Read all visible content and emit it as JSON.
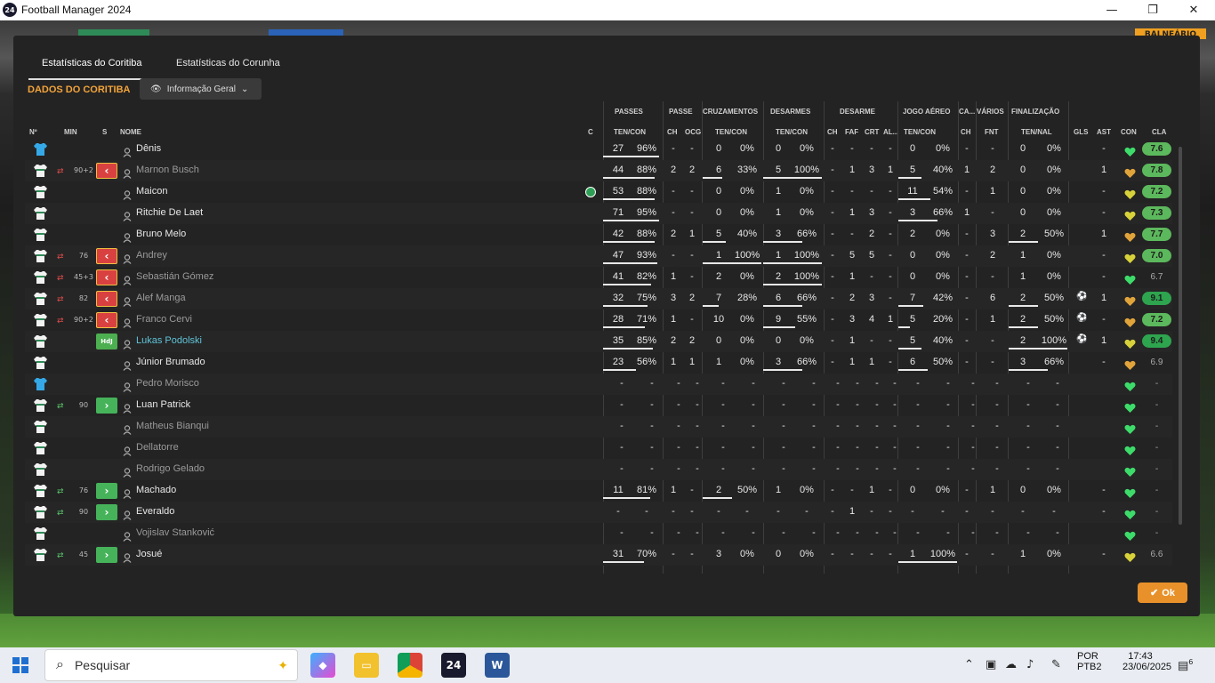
{
  "window": {
    "title": "Football Manager 2024",
    "logo_text": "24",
    "minimize": "—",
    "maximize": "❐",
    "close": "✕"
  },
  "background": {
    "balneario": "BALNEÁRIO"
  },
  "tabs": [
    {
      "label": "Estatísticas do Coritiba",
      "active": true
    },
    {
      "label": "Estatísticas do Corunha",
      "active": false
    }
  ],
  "section_title": "DADOS DO CORITIBA",
  "view_selector": {
    "label": "Informação Geral"
  },
  "group_headers": [
    "PASSES",
    "PASSE",
    "CRUZAMENTOS",
    "DESARMES",
    "DESARME",
    "JOGO AÉREO",
    "CA...",
    "VÁRIOS",
    "FINALIZAÇÃO"
  ],
  "columns": [
    "Nº",
    "MIN",
    "S",
    "NOME",
    "C",
    "TEN/CON",
    "CH",
    "OCG",
    "TEN/CON",
    "TEN/CON",
    "CH",
    "FAF",
    "CRT",
    "AL...",
    "TEN/CON",
    "CH",
    "FNT",
    "TEN/NAL",
    "GLS",
    "AST",
    "CON",
    "CLA"
  ],
  "players": [
    {
      "name": "Dênis",
      "gk": true,
      "min": "",
      "sub": "",
      "pass": [
        "27",
        "96%"
      ],
      "passe": [
        "-",
        "-"
      ],
      "cruz": [
        "0",
        "0%"
      ],
      "desarmes": [
        "0",
        "0%"
      ],
      "desarme": [
        "-",
        "-",
        "-",
        "-"
      ],
      "aereo": [
        "0",
        "0%"
      ],
      "ca": "-",
      "fnt": "-",
      "final": [
        "0",
        "0%"
      ],
      "gls": "",
      "ast": "-",
      "heart": "green",
      "cla": "7.6",
      "cla_color": "#5cb85c",
      "pbar": 0.96,
      "cbar": 0,
      "dbar": 0,
      "abar": 0,
      "fbar": 0
    },
    {
      "name": "Marnon Busch",
      "dim": true,
      "min": "90+2",
      "sub": "out",
      "pass": [
        "44",
        "88%"
      ],
      "passe": [
        "2",
        "2"
      ],
      "cruz": [
        "6",
        "33%"
      ],
      "desarmes": [
        "5",
        "100%"
      ],
      "desarme": [
        "-",
        "1",
        "3",
        "1"
      ],
      "aereo": [
        "5",
        "40%"
      ],
      "ca": "1",
      "fnt": "2",
      "final": [
        "0",
        "0%"
      ],
      "gls": "",
      "ast": "1",
      "heart": "orange",
      "cla": "7.8",
      "cla_color": "#5cb85c",
      "pbar": 0.88,
      "cbar": 0.33,
      "dbar": 1.0,
      "abar": 0.4,
      "fbar": 0
    },
    {
      "name": "Maicon",
      "min": "",
      "sub": "",
      "club": true,
      "pass": [
        "53",
        "88%"
      ],
      "passe": [
        "-",
        "-"
      ],
      "cruz": [
        "0",
        "0%"
      ],
      "desarmes": [
        "1",
        "0%"
      ],
      "desarme": [
        "-",
        "-",
        "-",
        "-"
      ],
      "aereo": [
        "11",
        "54%"
      ],
      "ca": "-",
      "fnt": "1",
      "final": [
        "0",
        "0%"
      ],
      "gls": "",
      "ast": "-",
      "heart": "yellow",
      "cla": "7.2",
      "cla_color": "#5cb85c",
      "pbar": 0.88,
      "cbar": 0,
      "dbar": 0,
      "abar": 0.54,
      "fbar": 0
    },
    {
      "name": "Ritchie De Laet",
      "min": "",
      "sub": "",
      "pass": [
        "71",
        "95%"
      ],
      "passe": [
        "-",
        "-"
      ],
      "cruz": [
        "0",
        "0%"
      ],
      "desarmes": [
        "1",
        "0%"
      ],
      "desarme": [
        "-",
        "1",
        "3",
        "-"
      ],
      "aereo": [
        "3",
        "66%"
      ],
      "ca": "1",
      "fnt": "-",
      "final": [
        "0",
        "0%"
      ],
      "gls": "",
      "ast": "-",
      "heart": "yellow",
      "cla": "7.3",
      "cla_color": "#5cb85c",
      "pbar": 0.95,
      "cbar": 0,
      "dbar": 0,
      "abar": 0.66,
      "fbar": 0
    },
    {
      "name": "Bruno Melo",
      "min": "",
      "sub": "",
      "pass": [
        "42",
        "88%"
      ],
      "passe": [
        "2",
        "1"
      ],
      "cruz": [
        "5",
        "40%"
      ],
      "desarmes": [
        "3",
        "66%"
      ],
      "desarme": [
        "-",
        "-",
        "2",
        "-"
      ],
      "aereo": [
        "2",
        "0%"
      ],
      "ca": "-",
      "fnt": "3",
      "final": [
        "2",
        "50%"
      ],
      "gls": "",
      "ast": "1",
      "heart": "orange",
      "cla": "7.7",
      "cla_color": "#5cb85c",
      "pbar": 0.88,
      "cbar": 0.4,
      "dbar": 0.66,
      "abar": 0,
      "fbar": 0.5
    },
    {
      "name": "Andrey",
      "dim": true,
      "min": "76",
      "sub": "out",
      "pass": [
        "47",
        "93%"
      ],
      "passe": [
        "-",
        "-"
      ],
      "cruz": [
        "1",
        "100%"
      ],
      "desarmes": [
        "1",
        "100%"
      ],
      "desarme": [
        "-",
        "5",
        "5",
        "-"
      ],
      "aereo": [
        "0",
        "0%"
      ],
      "ca": "-",
      "fnt": "2",
      "final": [
        "1",
        "0%"
      ],
      "gls": "",
      "ast": "-",
      "heart": "yellow",
      "cla": "7.0",
      "cla_color": "#5cb85c",
      "pbar": 0.93,
      "cbar": 1.0,
      "dbar": 1.0,
      "abar": 0,
      "fbar": 0
    },
    {
      "name": "Sebastián Gómez",
      "dim": true,
      "min": "45+3",
      "sub": "out",
      "pass": [
        "41",
        "82%"
      ],
      "passe": [
        "1",
        "-"
      ],
      "cruz": [
        "2",
        "0%"
      ],
      "desarmes": [
        "2",
        "100%"
      ],
      "desarme": [
        "-",
        "1",
        "-",
        "-"
      ],
      "aereo": [
        "0",
        "0%"
      ],
      "ca": "-",
      "fnt": "-",
      "final": [
        "1",
        "0%"
      ],
      "gls": "",
      "ast": "-",
      "heart": "green",
      "cla": "6.7",
      "cla_color": "",
      "pbar": 0.82,
      "cbar": 0,
      "dbar": 1.0,
      "abar": 0,
      "fbar": 0
    },
    {
      "name": "Alef Manga",
      "dim": true,
      "min": "82",
      "sub": "out",
      "pass": [
        "32",
        "75%"
      ],
      "passe": [
        "3",
        "2"
      ],
      "cruz": [
        "7",
        "28%"
      ],
      "desarmes": [
        "6",
        "66%"
      ],
      "desarme": [
        "-",
        "2",
        "3",
        "-"
      ],
      "aereo": [
        "7",
        "42%"
      ],
      "ca": "-",
      "fnt": "6",
      "final": [
        "2",
        "50%"
      ],
      "gls": "ball",
      "ast": "1",
      "heart": "orange",
      "cla": "9.1",
      "cla_color": "#2ea44f",
      "pbar": 0.75,
      "cbar": 0.28,
      "dbar": 0.66,
      "abar": 0.42,
      "fbar": 0.5
    },
    {
      "name": "Franco Cervi",
      "dim": true,
      "min": "90+2",
      "sub": "out",
      "pass": [
        "28",
        "71%"
      ],
      "passe": [
        "1",
        "-"
      ],
      "cruz": [
        "10",
        "0%"
      ],
      "desarmes": [
        "9",
        "55%"
      ],
      "desarme": [
        "-",
        "3",
        "4",
        "1"
      ],
      "aereo": [
        "5",
        "20%"
      ],
      "ca": "-",
      "fnt": "1",
      "final": [
        "2",
        "50%"
      ],
      "gls": "ball",
      "ast": "-",
      "heart": "orange",
      "cla": "7.2",
      "cla_color": "#5cb85c",
      "pbar": 0.71,
      "cbar": 0,
      "dbar": 0.55,
      "abar": 0.2,
      "fbar": 0.5
    },
    {
      "name": "Lukas Podolski",
      "link": true,
      "min": "",
      "sub": "hdj",
      "pass": [
        "35",
        "85%"
      ],
      "passe": [
        "2",
        "2"
      ],
      "cruz": [
        "0",
        "0%"
      ],
      "desarmes": [
        "0",
        "0%"
      ],
      "desarme": [
        "-",
        "1",
        "-",
        "-"
      ],
      "aereo": [
        "5",
        "40%"
      ],
      "ca": "-",
      "fnt": "-",
      "final": [
        "2",
        "100%"
      ],
      "gls": "ball2",
      "ast": "1",
      "heart": "yellow",
      "cla": "9.4",
      "cla_color": "#2ea44f",
      "pbar": 0.85,
      "cbar": 0,
      "dbar": 0,
      "abar": 0.4,
      "fbar": 1.0
    },
    {
      "name": "Júnior Brumado",
      "min": "",
      "sub": "",
      "pass": [
        "23",
        "56%"
      ],
      "passe": [
        "1",
        "1"
      ],
      "cruz": [
        "1",
        "0%"
      ],
      "desarmes": [
        "3",
        "66%"
      ],
      "desarme": [
        "-",
        "1",
        "1",
        "-"
      ],
      "aereo": [
        "6",
        "50%"
      ],
      "ca": "-",
      "fnt": "-",
      "final": [
        "3",
        "66%"
      ],
      "gls": "",
      "ast": "-",
      "heart": "orange",
      "cla": "6.9",
      "cla_color": "",
      "pbar": 0.56,
      "cbar": 0,
      "dbar": 0.66,
      "abar": 0.5,
      "fbar": 0.66
    },
    {
      "name": "Pedro Morisco",
      "gk": true,
      "dim": true,
      "min": "",
      "sub": "",
      "empty": true,
      "heart": "green",
      "cla": "-"
    },
    {
      "name": "Luan Patrick",
      "min": "90",
      "sub": "in",
      "empty": true,
      "heart": "green",
      "cla": "-"
    },
    {
      "name": "Matheus Bianqui",
      "dim": true,
      "min": "",
      "sub": "",
      "empty": true,
      "heart": "green",
      "cla": "-"
    },
    {
      "name": "Dellatorre",
      "dim": true,
      "min": "",
      "sub": "",
      "empty": true,
      "heart": "green",
      "cla": "-"
    },
    {
      "name": "Rodrigo Gelado",
      "dim": true,
      "min": "",
      "sub": "",
      "empty": true,
      "heart": "green",
      "cla": "-"
    },
    {
      "name": "Machado",
      "min": "76",
      "sub": "in",
      "pass": [
        "11",
        "81%"
      ],
      "passe": [
        "1",
        "-"
      ],
      "cruz": [
        "2",
        "50%"
      ],
      "desarmes": [
        "1",
        "0%"
      ],
      "desarme": [
        "-",
        "-",
        "1",
        "-"
      ],
      "aereo": [
        "0",
        "0%"
      ],
      "ca": "-",
      "fnt": "1",
      "final": [
        "0",
        "0%"
      ],
      "gls": "",
      "ast": "-",
      "heart": "green",
      "cla": "-",
      "cla_color": "",
      "pbar": 0.81,
      "cbar": 0.5,
      "dbar": 0,
      "abar": 0,
      "fbar": 0
    },
    {
      "name": "Everaldo",
      "min": "90",
      "sub": "in",
      "pass": [
        "-",
        "-"
      ],
      "passe": [
        "-",
        "-"
      ],
      "cruz": [
        "-",
        "-"
      ],
      "desarmes": [
        "-",
        "-"
      ],
      "desarme": [
        "-",
        "1",
        "-",
        "-"
      ],
      "aereo": [
        "-",
        "-"
      ],
      "ca": "-",
      "fnt": "-",
      "final": [
        "-",
        "-"
      ],
      "gls": "",
      "ast": "-",
      "heart": "green",
      "cla": "-",
      "cla_color": "",
      "pbar": 0,
      "cbar": 0,
      "dbar": 0,
      "abar": 0,
      "fbar": 0
    },
    {
      "name": "Vojislav Stanković",
      "dim": true,
      "min": "",
      "sub": "",
      "empty": true,
      "heart": "green",
      "cla": "-"
    },
    {
      "name": "Josué",
      "min": "45",
      "sub": "in",
      "pass": [
        "31",
        "70%"
      ],
      "passe": [
        "-",
        "-"
      ],
      "cruz": [
        "3",
        "0%"
      ],
      "desarmes": [
        "0",
        "0%"
      ],
      "desarme": [
        "-",
        "-",
        "-",
        "-"
      ],
      "aereo": [
        "1",
        "100%"
      ],
      "ca": "-",
      "fnt": "-",
      "final": [
        "1",
        "0%"
      ],
      "gls": "",
      "ast": "-",
      "heart": "yellow",
      "cla": "6.6",
      "cla_color": "",
      "pbar": 0.7,
      "cbar": 0,
      "dbar": 0,
      "abar": 1.0,
      "fbar": 0
    }
  ],
  "hdj_label": "HdJ",
  "ok_button": "Ok",
  "taskbar": {
    "search_placeholder": "Pesquisar",
    "lang": "POR",
    "layout": "PTB2",
    "time": "17:43",
    "date": "23/06/2025",
    "notifications": "6",
    "fm_label": "24"
  }
}
